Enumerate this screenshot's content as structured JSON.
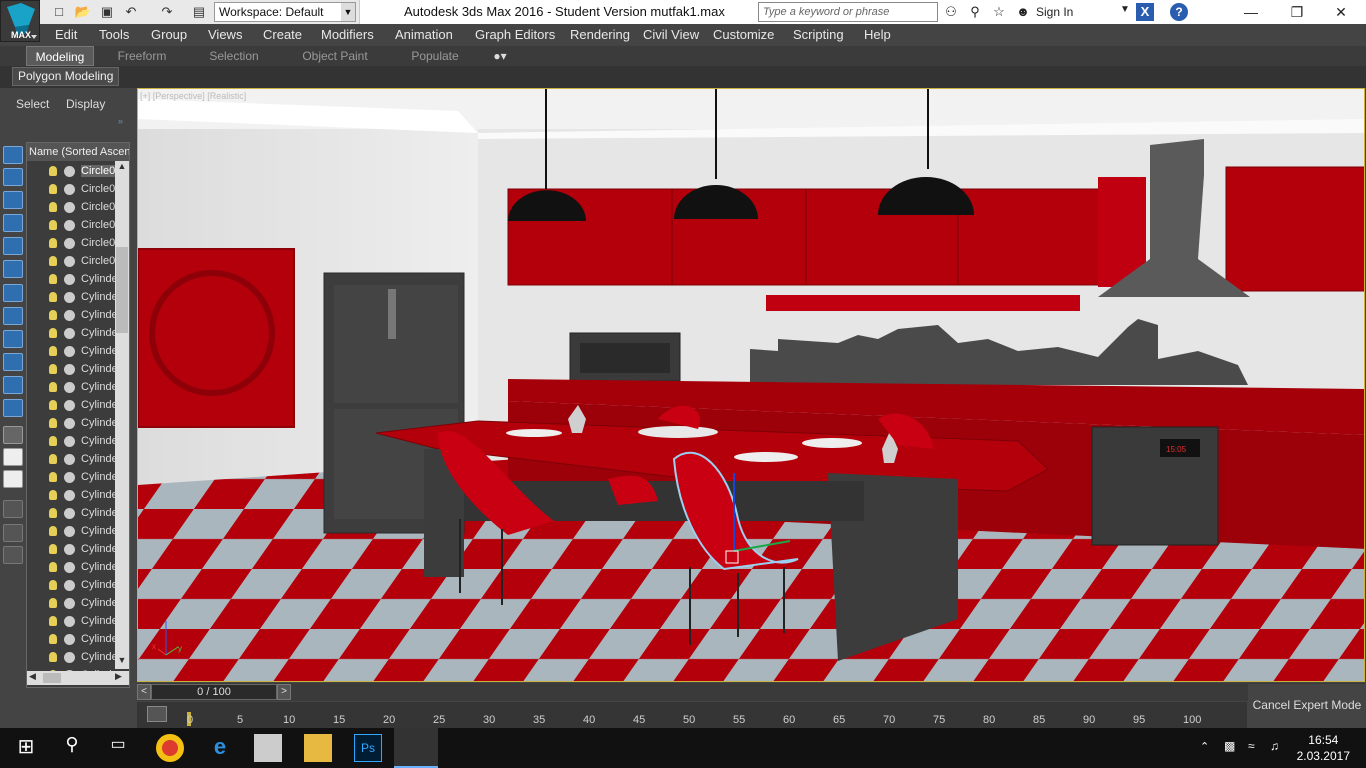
{
  "window": {
    "title": "Autodesk 3ds Max 2016 - Student Version    mutfak1.max",
    "workspace_label": "Workspace: Default",
    "search_placeholder": "Type a keyword or phrase",
    "sign_in": "Sign In",
    "logo_text": "MAX"
  },
  "menu": [
    "Edit",
    "Tools",
    "Group",
    "Views",
    "Create",
    "Modifiers",
    "Animation",
    "Graph Editors",
    "Rendering",
    "Civil View",
    "Customize",
    "Scripting",
    "Help"
  ],
  "ribbon": {
    "tabs": [
      "Modeling",
      "Freeform",
      "Selection",
      "Object Paint",
      "Populate"
    ],
    "active_tab": "Modeling",
    "panel_label": "Polygon Modeling"
  },
  "scene_explorer": {
    "menu_select": "Select",
    "menu_display": "Display",
    "header": "Name (Sorted Ascen",
    "rows": [
      "Circle0",
      "Circle0",
      "Circle0",
      "Circle0",
      "Circle0",
      "Circle0",
      "Cylinde",
      "Cylinde",
      "Cylinde",
      "Cylinde",
      "Cylinde",
      "Cylinde",
      "Cylinde",
      "Cylinde",
      "Cylinde",
      "Cylinde",
      "Cylinde",
      "Cylinde",
      "Cylinde",
      "Cylinde",
      "Cylinde",
      "Cylinde",
      "Cylinde",
      "Cylinde",
      "Cylinde",
      "Cylinde",
      "Cylinde",
      "Cylinde",
      "Cylinde"
    ]
  },
  "viewport": {
    "label": "[+] [Perspective] [Realistic]",
    "axis_x": "x",
    "axis_y": "y",
    "oven_display": "15:05"
  },
  "timeline": {
    "frame_counter": "0 / 100",
    "ticks": [
      "0",
      "5",
      "10",
      "15",
      "20",
      "25",
      "30",
      "35",
      "40",
      "45",
      "50",
      "55",
      "60",
      "65",
      "70",
      "75",
      "80",
      "85",
      "90",
      "95",
      "100"
    ],
    "cancel_expert": "Cancel Expert Mode"
  },
  "taskbar": {
    "time": "16:54",
    "date": "2.03.2017"
  },
  "colors": {
    "accent_blue": "#2f6fb0",
    "kitchen_red": "#b3000b",
    "floor_light": "#a9b6bd",
    "viewport_border": "#c9b33c"
  }
}
